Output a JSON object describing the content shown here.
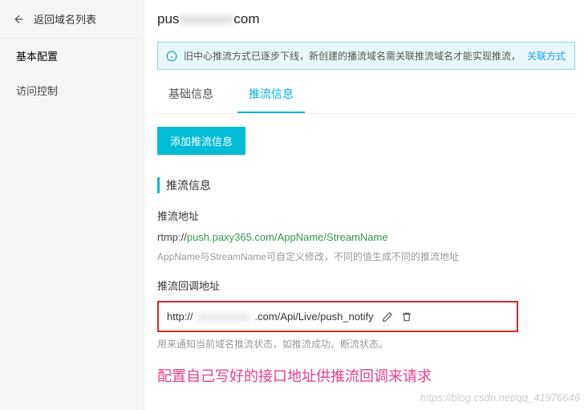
{
  "sidebar": {
    "back_label": "返回域名列表",
    "nav": [
      {
        "label": "基本配置",
        "active": true
      },
      {
        "label": "访问控制",
        "active": false
      }
    ]
  },
  "header": {
    "domain_prefix": "pus",
    "domain_mid_blurred": "xxxxxxxx",
    "domain_suffix": "com"
  },
  "notice": {
    "text": "旧中心推流方式已逐步下线，新创建的播流域名需关联推流域名才能实现推流，",
    "link_label": "关联方式"
  },
  "tabs": [
    {
      "label": "基础信息",
      "active": false
    },
    {
      "label": "推流信息",
      "active": true
    }
  ],
  "actions": {
    "add_push_info": "添加推流信息"
  },
  "section": {
    "title": "推流信息",
    "push_addr_label": "推流地址",
    "push_scheme": "rtmp://",
    "push_url": "push.paxy365.com/AppName/StreamName",
    "push_help": "AppName与StreamName可自定义修改，不同的值生成不同的推流地址",
    "callback_label": "推流回调地址",
    "callback_scheme": "http://",
    "callback_host_blurred": "xxxxxxxxxx",
    "callback_path": ".com/Api/Live/push_notify",
    "callback_help": "用来通知当前域名推流状态，如推流成功、断流状态。"
  },
  "annotation": "配置自己写好的接口地址供推流回调来请求",
  "watermark": "https://blog.csdn.net/qq_41976646"
}
